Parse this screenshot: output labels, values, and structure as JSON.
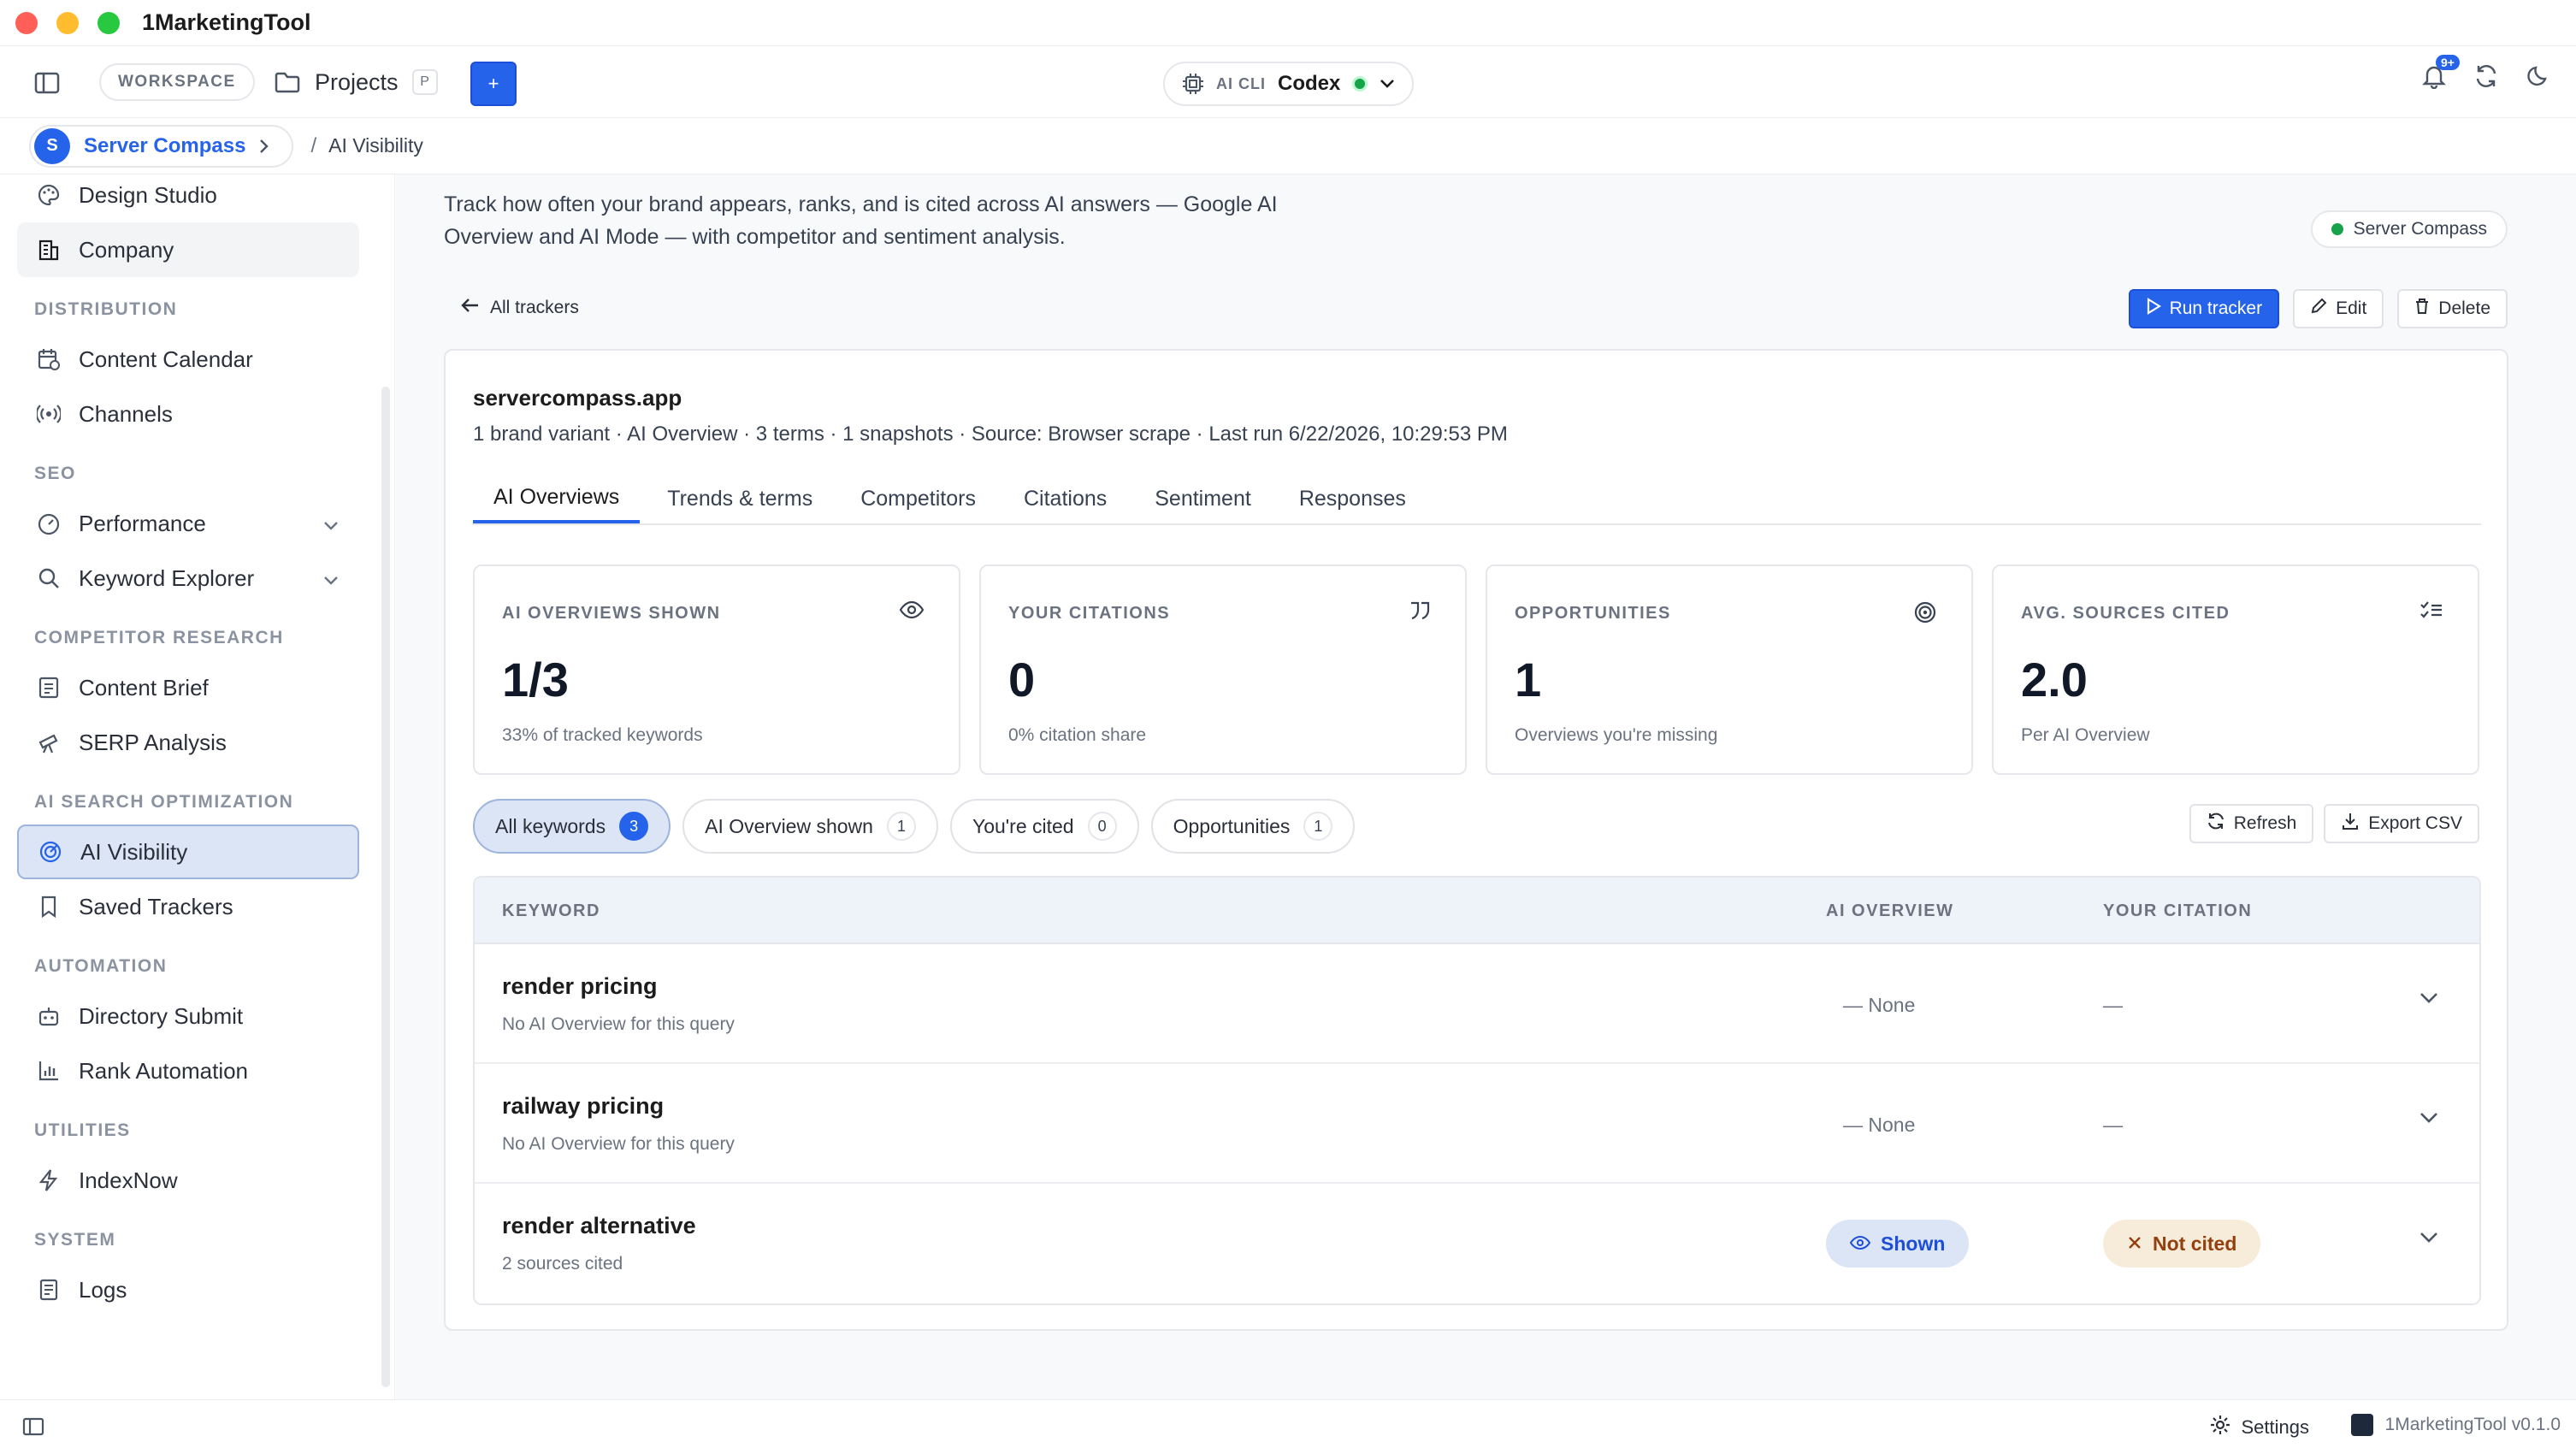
{
  "app": {
    "title": "1MarketingTool"
  },
  "toolbar": {
    "workspace_label": "WORKSPACE",
    "projects_label": "Projects",
    "projects_shortcut": "P",
    "add_label": "+",
    "ai_cli_label": "AI CLI",
    "ai_cli_value": "Codex",
    "notifications_badge": "9+"
  },
  "breadcrumb": {
    "avatar_letter": "S",
    "project": "Server Compass",
    "separator": "/",
    "page": "AI Visibility"
  },
  "sidebar": {
    "top_items": [
      {
        "label": "Design Studio",
        "icon": "palette-icon"
      },
      {
        "label": "Company",
        "icon": "building-icon"
      }
    ],
    "sections": [
      {
        "title": "DISTRIBUTION",
        "items": [
          {
            "label": "Content Calendar"
          },
          {
            "label": "Channels"
          }
        ]
      },
      {
        "title": "SEO",
        "items": [
          {
            "label": "Performance"
          },
          {
            "label": "Keyword Explorer"
          }
        ]
      },
      {
        "title": "COMPETITOR RESEARCH",
        "items": [
          {
            "label": "Content Brief"
          },
          {
            "label": "SERP Analysis"
          }
        ]
      },
      {
        "title": "AI SEARCH OPTIMIZATION",
        "items": [
          {
            "label": "AI Visibility"
          },
          {
            "label": "Saved Trackers"
          }
        ]
      },
      {
        "title": "AUTOMATION",
        "items": [
          {
            "label": "Directory Submit"
          },
          {
            "label": "Rank Automation"
          }
        ]
      },
      {
        "title": "UTILITIES",
        "items": [
          {
            "label": "IndexNow"
          }
        ]
      },
      {
        "title": "SYSTEM",
        "items": [
          {
            "label": "Logs"
          }
        ]
      }
    ]
  },
  "main": {
    "description": "Track how often your brand appears, ranks, and is cited across AI answers — Google AI Overview and AI Mode — with competitor and sentiment analysis.",
    "project_chip": "Server Compass",
    "back_label": "All trackers",
    "actions": {
      "run": "Run tracker",
      "edit": "Edit",
      "delete": "Delete"
    },
    "tracker": {
      "domain": "servercompass.app",
      "meta": "1 brand variant · AI Overview · 3 terms · 1 snapshots · Source: Browser scrape · Last run 6/22/2026, 10:29:53 PM"
    },
    "tabs": [
      "AI Overviews",
      "Trends & terms",
      "Competitors",
      "Citations",
      "Sentiment",
      "Responses"
    ],
    "stats": [
      {
        "label": "AI OVERVIEWS SHOWN",
        "value": "1/3",
        "sub": "33% of tracked keywords",
        "icon": "eye-icon"
      },
      {
        "label": "YOUR CITATIONS",
        "value": "0",
        "sub": "0% citation share",
        "icon": "quote-icon"
      },
      {
        "label": "OPPORTUNITIES",
        "value": "1",
        "sub": "Overviews you're missing",
        "icon": "target-icon"
      },
      {
        "label": "AVG. SOURCES CITED",
        "value": "2.0",
        "sub": "Per AI Overview",
        "icon": "checklist-icon"
      }
    ],
    "filters": [
      {
        "label": "All keywords",
        "count": "3"
      },
      {
        "label": "AI Overview shown",
        "count": "1"
      },
      {
        "label": "You're cited",
        "count": "0"
      },
      {
        "label": "Opportunities",
        "count": "1"
      }
    ],
    "table_actions": {
      "refresh": "Refresh",
      "export": "Export CSV"
    },
    "table": {
      "headers": {
        "keyword": "KEYWORD",
        "ai_overview": "AI OVERVIEW",
        "citation": "YOUR CITATION"
      },
      "rows": [
        {
          "keyword": "render pricing",
          "sub": "No AI Overview for this query",
          "overview": "— None",
          "citation": "—"
        },
        {
          "keyword": "railway pricing",
          "sub": "No AI Overview for this query",
          "overview": "— None",
          "citation": "—"
        },
        {
          "keyword": "render alternative",
          "sub": "2 sources cited",
          "overview": "Shown",
          "citation": "Not cited"
        }
      ]
    }
  },
  "statusbar": {
    "settings": "Settings",
    "version": "1MarketingTool v0.1.0"
  }
}
